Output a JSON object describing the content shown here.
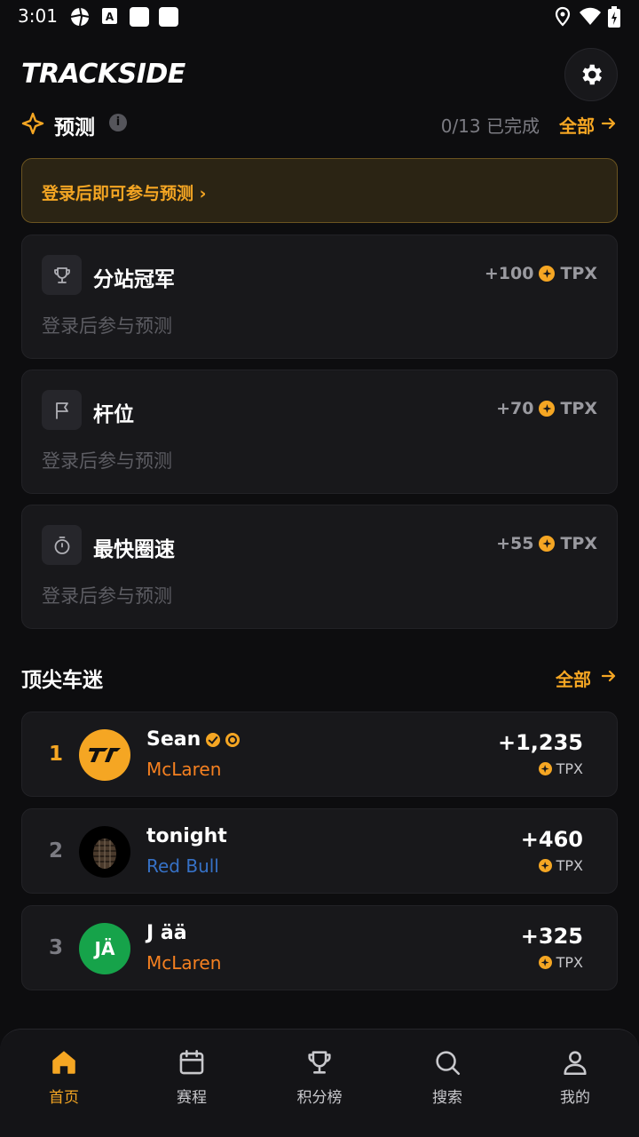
{
  "status_bar": {
    "time": "3:01"
  },
  "app": {
    "logo_text": "TRACKSIDE"
  },
  "predictions": {
    "title": "预测",
    "progress": "0/13 已完成",
    "all_link": "全部",
    "login_banner": "登录后即可参与预测 ›",
    "cards": [
      {
        "name": "分站冠军",
        "reward": "+100",
        "unit": "TPX",
        "subtitle": "登录后参与预测",
        "icon": "trophy-icon"
      },
      {
        "name": "杆位",
        "reward": "+70",
        "unit": "TPX",
        "subtitle": "登录后参与预测",
        "icon": "flag-icon"
      },
      {
        "name": "最快圈速",
        "reward": "+55",
        "unit": "TPX",
        "subtitle": "登录后参与预测",
        "icon": "stopwatch-icon"
      }
    ]
  },
  "top_fans": {
    "title": "顶尖车迷",
    "all_link": "全部",
    "rows": [
      {
        "rank": "1",
        "name": "Sean",
        "team": "McLaren",
        "team_color": "#f58020",
        "points": "+1,235",
        "unit": "TPX"
      },
      {
        "rank": "2",
        "name": "tonight",
        "team": "Red Bull",
        "team_color": "#3671c6",
        "points": "+460",
        "unit": "TPX"
      },
      {
        "rank": "3",
        "name": "J ää",
        "team": "McLaren",
        "team_color": "#f58020",
        "points": "+325",
        "unit": "TPX",
        "avatar_initials": "JÄ"
      }
    ]
  },
  "bottom_nav": {
    "items": [
      {
        "label": "首页",
        "icon": "home-icon",
        "active": true
      },
      {
        "label": "赛程",
        "icon": "calendar-icon",
        "active": false
      },
      {
        "label": "积分榜",
        "icon": "trophy-icon",
        "active": false
      },
      {
        "label": "搜索",
        "icon": "search-icon",
        "active": false
      },
      {
        "label": "我的",
        "icon": "profile-icon",
        "active": false
      }
    ]
  },
  "colors": {
    "accent": "#f5a623",
    "background": "#0d0d0f",
    "card": "#18181b"
  }
}
